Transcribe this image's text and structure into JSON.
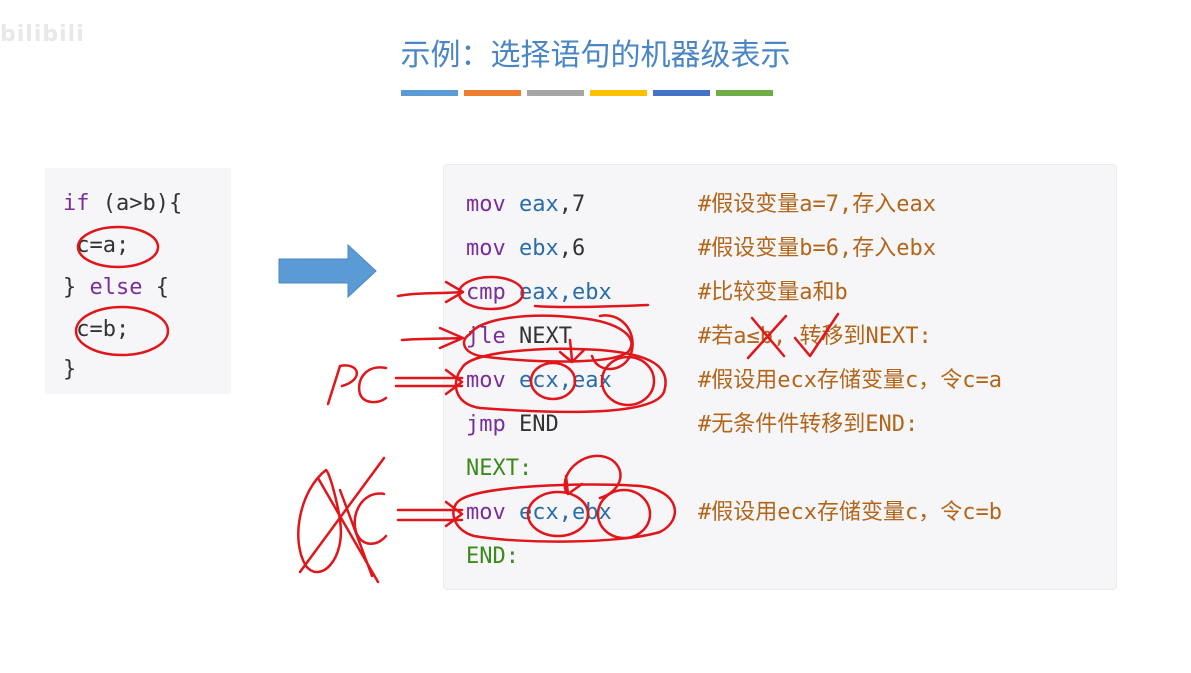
{
  "watermark": "bilibili",
  "title": "示例：选择语句的机器级表示",
  "title_bar_colors": [
    "#5b9bd5",
    "#ed7d31",
    "#a5a5a5",
    "#ffc000",
    "#4472c4",
    "#70ad47"
  ],
  "c_code": {
    "lines": [
      {
        "kw": "if",
        "rest": " (a>b){"
      },
      {
        "text": " c=a;"
      },
      {
        "pre": "} ",
        "kw": "else",
        "rest": " {"
      },
      {
        "text": " c=b;"
      },
      {
        "text": "}"
      }
    ]
  },
  "asm": [
    {
      "op": "mov",
      "args": "eax",
      "args2": ",7",
      "comment": "#假设变量a=7,存入eax"
    },
    {
      "op": "mov",
      "args": "ebx",
      "args2": ",6",
      "comment": "#假设变量b=6,存入ebx"
    },
    {
      "op": "cmp",
      "args": "eax,ebx",
      "args2": "",
      "comment": "#比较变量a和b"
    },
    {
      "op": "jle",
      "args": "NEXT",
      "args2": "",
      "comment": "#若a≤b, 转移到NEXT:"
    },
    {
      "op": "mov",
      "args": "ecx,eax",
      "args2": "",
      "comment": "#假设用ecx存储变量c，令c=a"
    },
    {
      "op": "jmp",
      "args": "END",
      "args2": "",
      "comment": "#无条件件转移到END:"
    },
    {
      "label": "NEXT:"
    },
    {
      "op": "mov",
      "args": "ecx,ebx",
      "args2": "",
      "comment": "#假设用ecx存储变量c，令c=b"
    },
    {
      "label": "END:"
    }
  ],
  "annotations": {
    "pc_label": "PC",
    "crossed_label": "PC"
  },
  "colors": {
    "title": "#4a86c5",
    "keyword": "#7a2e9b",
    "register": "#2a6ca8",
    "label": "#3c8a1c",
    "comment": "#b3651a",
    "ink": "#e0161b",
    "arrow": "#5b9bd5"
  }
}
